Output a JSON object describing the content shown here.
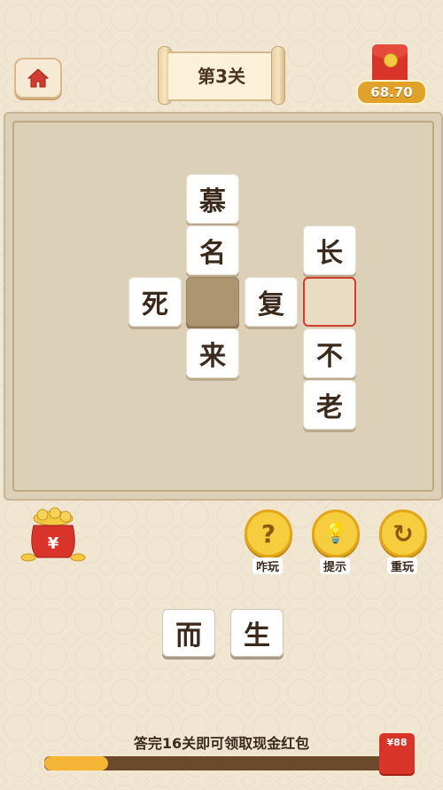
{
  "header": {
    "level_title": "第3关",
    "balance": "68.70"
  },
  "board": {
    "cells": [
      {
        "id": "r1c2",
        "text": "慕",
        "state": "filled"
      },
      {
        "id": "r2c2",
        "text": "名",
        "state": "filled"
      },
      {
        "id": "r2c4",
        "text": "长",
        "state": "filled"
      },
      {
        "id": "r3c1",
        "text": "死",
        "state": "filled"
      },
      {
        "id": "r3c2",
        "text": "",
        "state": "empty"
      },
      {
        "id": "r3c3",
        "text": "复",
        "state": "filled"
      },
      {
        "id": "r3c4",
        "text": "",
        "state": "target"
      },
      {
        "id": "r4c2",
        "text": "来",
        "state": "filled"
      },
      {
        "id": "r4c4",
        "text": "不",
        "state": "filled"
      },
      {
        "id": "r5c4",
        "text": "老",
        "state": "filled"
      }
    ]
  },
  "actions": [
    {
      "label": "咋玩",
      "icon": "question-icon",
      "glyph": "?"
    },
    {
      "label": "提示",
      "icon": "lightbulb-icon",
      "glyph": "💡"
    },
    {
      "label": "重玩",
      "icon": "refresh-icon",
      "glyph": "↻"
    }
  ],
  "choices": [
    "而",
    "生"
  ],
  "progress": {
    "text": "答完16关即可领取现金红包",
    "fraction": 0.18,
    "reward_label": "¥88"
  },
  "colors": {
    "accent": "#f4b536",
    "red": "#d8342a",
    "board": "#ddd0b8"
  }
}
